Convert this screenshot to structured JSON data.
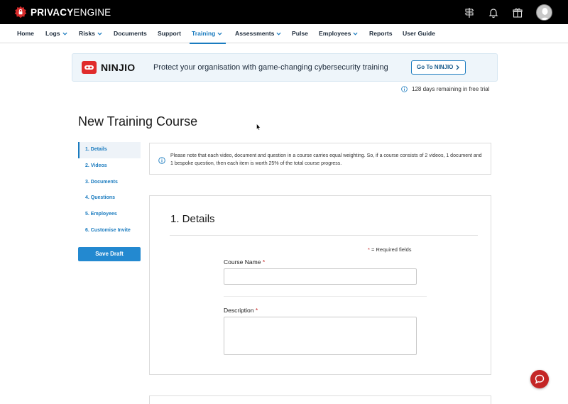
{
  "app": {
    "brand_bold": "PRIVACY",
    "brand_light": "ENGINE"
  },
  "nav": {
    "items": [
      {
        "label": "Home",
        "dropdown": false
      },
      {
        "label": "Logs",
        "dropdown": true
      },
      {
        "label": "Risks",
        "dropdown": true
      },
      {
        "label": "Documents",
        "dropdown": false
      },
      {
        "label": "Support",
        "dropdown": false
      },
      {
        "label": "Training",
        "dropdown": true,
        "active": true
      },
      {
        "label": "Assessments",
        "dropdown": true
      },
      {
        "label": "Pulse",
        "dropdown": false
      },
      {
        "label": "Employees",
        "dropdown": true
      },
      {
        "label": "Reports",
        "dropdown": false
      },
      {
        "label": "User Guide",
        "dropdown": false
      }
    ]
  },
  "top_icons": [
    "signpost-icon",
    "bell-icon",
    "gift-icon",
    "user-avatar"
  ],
  "banner": {
    "logo_text": "NINJIO",
    "message": "Protect your organisation with game-changing cybersecurity training",
    "button_label": "Go To NINJIO"
  },
  "trial": {
    "text": "128 days remaining in free trial"
  },
  "page": {
    "title": "New Training Course"
  },
  "steps": [
    {
      "label": "1. Details",
      "active": true
    },
    {
      "label": "2. Videos"
    },
    {
      "label": "3. Documents"
    },
    {
      "label": "4. Questions"
    },
    {
      "label": "5. Employees"
    },
    {
      "label": "6. Customise Invite"
    }
  ],
  "actions": {
    "save_draft": "Save Draft"
  },
  "notice": {
    "text": "Please note that each video, document and question in a course carries equal weighting. So, if a course consists of 2 videos, 1 document and 1 bespoke question, then each item is worth 25% of the total course progress."
  },
  "form": {
    "section_title": "1. Details",
    "required_star": "*",
    "required_note": " = Required fields",
    "course_name_label": "Course Name",
    "course_name_value": "",
    "description_label": "Description",
    "description_value": ""
  },
  "colors": {
    "accent": "#1a7bbf",
    "brand_red": "#c42626",
    "topbar": "#000000",
    "banner_bg": "#eef5fa"
  }
}
